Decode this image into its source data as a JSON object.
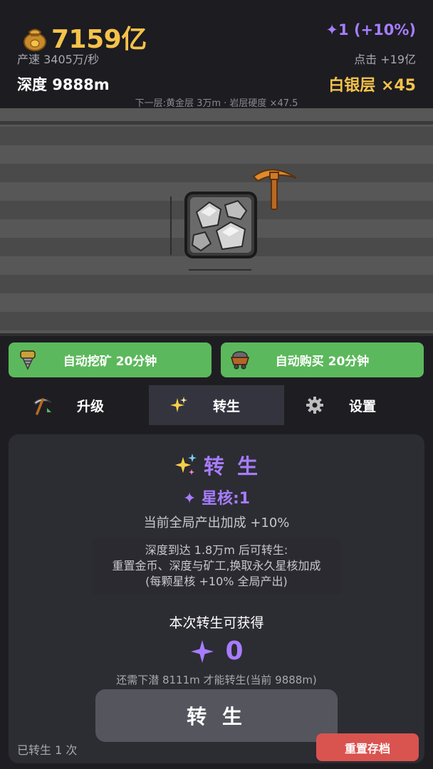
{
  "header": {
    "gold": "7159亿",
    "star_bonus": "✦1 (+10%)",
    "production": "产速 3405万/秒",
    "click_value": "点击 +19亿",
    "depth": "深度 9888m",
    "layer": "白银层 ×45",
    "next_layer": "下一层:黄金层 3万m · 岩层硬度 ×47.5"
  },
  "auto": {
    "mine_label": "自动挖矿 20分钟",
    "buy_label": "自动购买 20分钟"
  },
  "tabs": [
    {
      "label": "升级",
      "icon": "pickaxe-icon"
    },
    {
      "label": "转生",
      "icon": "sparkle-icon",
      "active": true
    },
    {
      "label": "设置",
      "icon": "gear-icon"
    }
  ],
  "rebirth": {
    "title": "转 生",
    "star_core": "✦ 星核:1",
    "global_bonus": "当前全局产出加成 +10%",
    "info_lines": [
      "深度到达 1.8万m 后可转生:",
      "重置金币、深度与矿工,换取永久星核加成",
      "(每颗星核 +10% 全局产出)"
    ],
    "gain_label": "本次转生可获得",
    "gain_value": "0",
    "need_dive": "还需下潜 8111m 才能转生(当前 9888m)",
    "button_label": "转 生"
  },
  "footer": {
    "reborn_count": "已转生 1 次",
    "reset_label": "重置存档"
  },
  "colors": {
    "gold": "#f5c24a",
    "purple": "#a67dff",
    "green": "#5cb85c",
    "red": "#d9534f"
  }
}
